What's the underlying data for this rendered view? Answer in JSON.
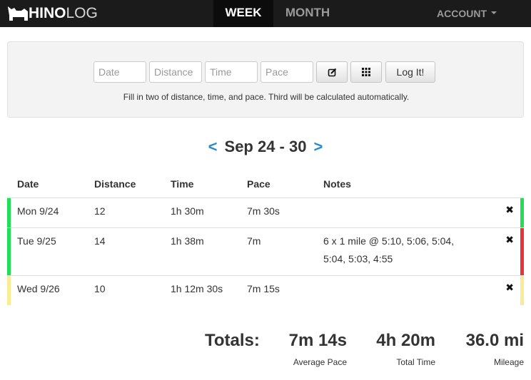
{
  "navbar": {
    "brand_bold_1": "HINO",
    "brand_light": "LOG",
    "tabs": [
      {
        "label": "WEEK",
        "active": true
      },
      {
        "label": "MONTH",
        "active": false
      }
    ],
    "account_label": "ACCOUNT",
    "icons": {
      "logo": "rhino-icon",
      "account": "caret-down-icon"
    }
  },
  "form": {
    "date_placeholder": "Date",
    "distance_placeholder": "Distance",
    "time_placeholder": "Time",
    "pace_placeholder": "Pace",
    "edit_icon": "edit-icon",
    "grid_icon": "grid-icon",
    "submit_label": "Log It!",
    "help_text": "Fill in two of distance, time, and pace. Third will be calculated automatically."
  },
  "week_nav": {
    "prev": "<",
    "label": "Sep 24 - 30",
    "next": ">"
  },
  "table": {
    "headers": [
      "Date",
      "Distance",
      "Time",
      "Pace",
      "Notes"
    ],
    "rows": [
      {
        "date": "Mon 9/24",
        "distance": "12",
        "time": "1h 30m",
        "pace": "7m 30s",
        "notes": "",
        "left_color": "#22dd55",
        "right_color": "#22dd55"
      },
      {
        "date": "Tue 9/25",
        "distance": "14",
        "time": "1h 38m",
        "pace": "7m",
        "notes_line1": "6 x 1 mile @ 5:10, 5:06, 5:04,",
        "notes_line2": "5:04, 5:03, 4:55",
        "left_color": "#22dd55",
        "right_color": "#e8333a"
      },
      {
        "date": "Wed 9/26",
        "distance": "10",
        "time": "1h 12m 30s",
        "pace": "7m 15s",
        "notes": "",
        "left_color": "#f8ec94",
        "right_color": "#f8ec94"
      }
    ],
    "delete_glyph": "✖"
  },
  "totals": {
    "label": "Totals:",
    "avg_pace": {
      "value": "7m 14s",
      "label": "Average Pace"
    },
    "total_time": {
      "value": "4h 20m",
      "label": "Total Time"
    },
    "mileage": {
      "value": "36.0 mi",
      "label": "Mileage"
    }
  }
}
